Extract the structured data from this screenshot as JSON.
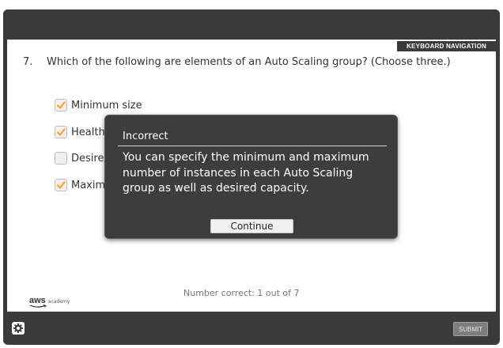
{
  "header": {
    "keyboard_nav_label": "KEYBOARD NAVIGATION"
  },
  "question": {
    "number": "7.",
    "text": "Which of the following are elements of an Auto Scaling group? (Choose three.)",
    "options": [
      {
        "label": "Minimum size",
        "checked": true
      },
      {
        "label": "Health",
        "checked": true
      },
      {
        "label": "Desired",
        "checked": false
      },
      {
        "label": "Maxim",
        "checked": true
      }
    ]
  },
  "feedback": {
    "title": "Incorrect",
    "message": "You can specify the minimum and maximum number of instances in each Auto Scaling group as well as desired capacity.",
    "continue_label": "Continue"
  },
  "footer": {
    "logo_main": "aws",
    "logo_sub": "academy",
    "score_text": "Number correct: 1 out of 7",
    "submit_label": "SUBMIT",
    "settings_icon": "gear-icon"
  },
  "colors": {
    "check_orange": "#f5a623",
    "chrome": "#3a3a3a",
    "modal_bg": "#3d3d3d"
  }
}
